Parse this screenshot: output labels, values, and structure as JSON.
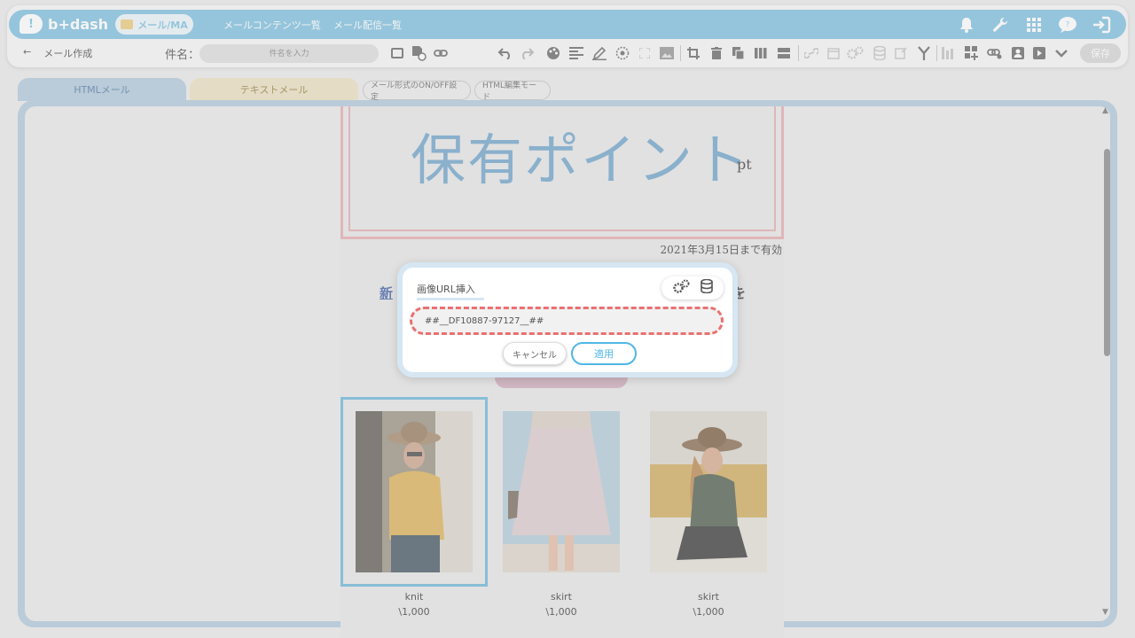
{
  "header": {
    "logo": "b+dash",
    "active_module": "メール/MA",
    "nav_links": [
      "メールコンテンツ一覧",
      "メール配信一覧"
    ],
    "icons": [
      "bell-icon",
      "wrench-icon",
      "apps-grid-icon",
      "chat-help-icon",
      "logout-icon"
    ]
  },
  "toolbar": {
    "back_label": "メール作成",
    "subject_label": "件名：",
    "subject_placeholder": "件名を入力",
    "save_label": "保存"
  },
  "tabs": {
    "html": "HTMLメール",
    "text": "テキストメール",
    "onoff": "メール形式のON/OFF設定",
    "html_edit": "HTML編集モード"
  },
  "email": {
    "points_title": "保有ポイント",
    "points_unit": "pt",
    "valid_until": "2021年3月15日まで有効",
    "link_left_fragment": "新",
    "link_right_fragment": "を",
    "products": [
      {
        "name": "knit",
        "price": "\\1,000"
      },
      {
        "name": "skirt",
        "price": "\\1,000"
      },
      {
        "name": "skirt",
        "price": "\\1,000"
      }
    ]
  },
  "modal": {
    "title": "画像URL挿入",
    "input_value": "##__DF10887-97127__##",
    "cancel_label": "キャンセル",
    "apply_label": "適用"
  },
  "colors": {
    "brand": "#6fb8dc",
    "html_tab": "#a8c2d8",
    "text_tab": "#e9dcb8",
    "dashed_highlight": "#e97171",
    "apply_accent": "#4fb7e6"
  }
}
